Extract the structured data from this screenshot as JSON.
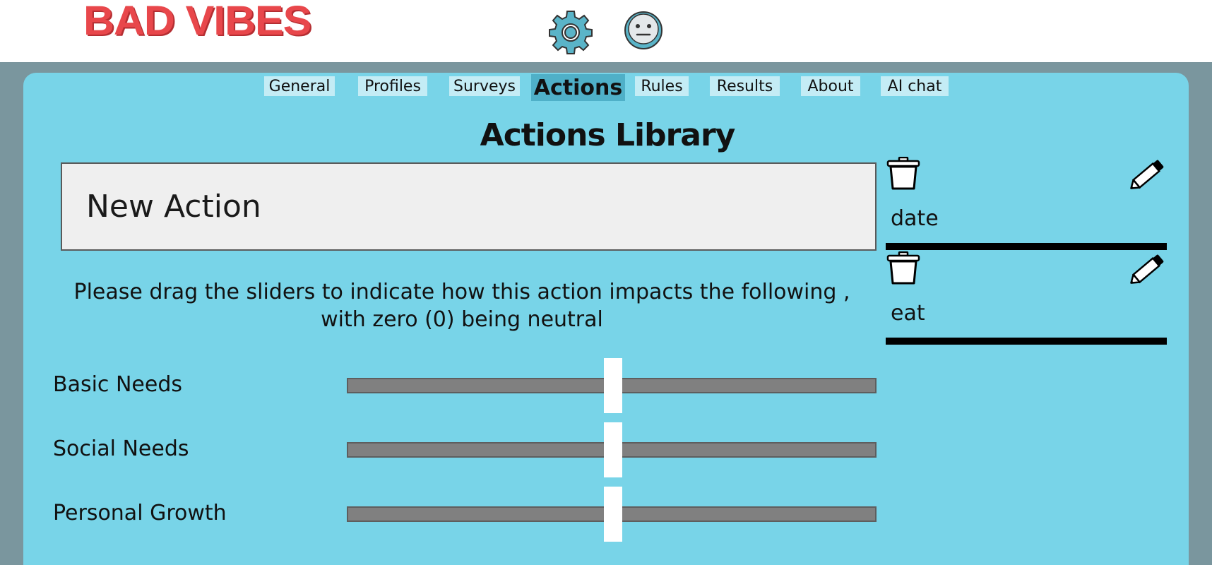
{
  "app": {
    "logo_text": "BAD VIBES"
  },
  "header": {
    "settings_icon": "gear-icon",
    "mood_icon": "neutral-face-icon"
  },
  "tabs": [
    {
      "label": "General",
      "active": false
    },
    {
      "label": "Profiles",
      "active": false
    },
    {
      "label": "Surveys",
      "active": false
    },
    {
      "label": "Actions",
      "active": true
    },
    {
      "label": "Rules",
      "active": false
    },
    {
      "label": "Results",
      "active": false
    },
    {
      "label": "About",
      "active": false
    },
    {
      "label": "AI chat",
      "active": false
    }
  ],
  "main": {
    "title": "Actions Library",
    "name_input_value": "New Action",
    "instructions": "Please drag the sliders to indicate how this action impacts the following , with zero (0) being neutral",
    "sliders": [
      {
        "label": "Basic Needs",
        "value": 0
      },
      {
        "label": "Social Needs",
        "value": 0
      },
      {
        "label": "Personal Growth",
        "value": 0
      }
    ]
  },
  "actions": [
    {
      "label": "date",
      "delete_icon": "trash-icon",
      "edit_icon": "pencil-icon"
    },
    {
      "label": "eat",
      "delete_icon": "trash-icon",
      "edit_icon": "pencil-icon"
    }
  ],
  "colors": {
    "panel": "#78d4e8",
    "backdrop": "#7a969e",
    "active_tab": "#4fb0c8",
    "logo": "#e8474b"
  }
}
